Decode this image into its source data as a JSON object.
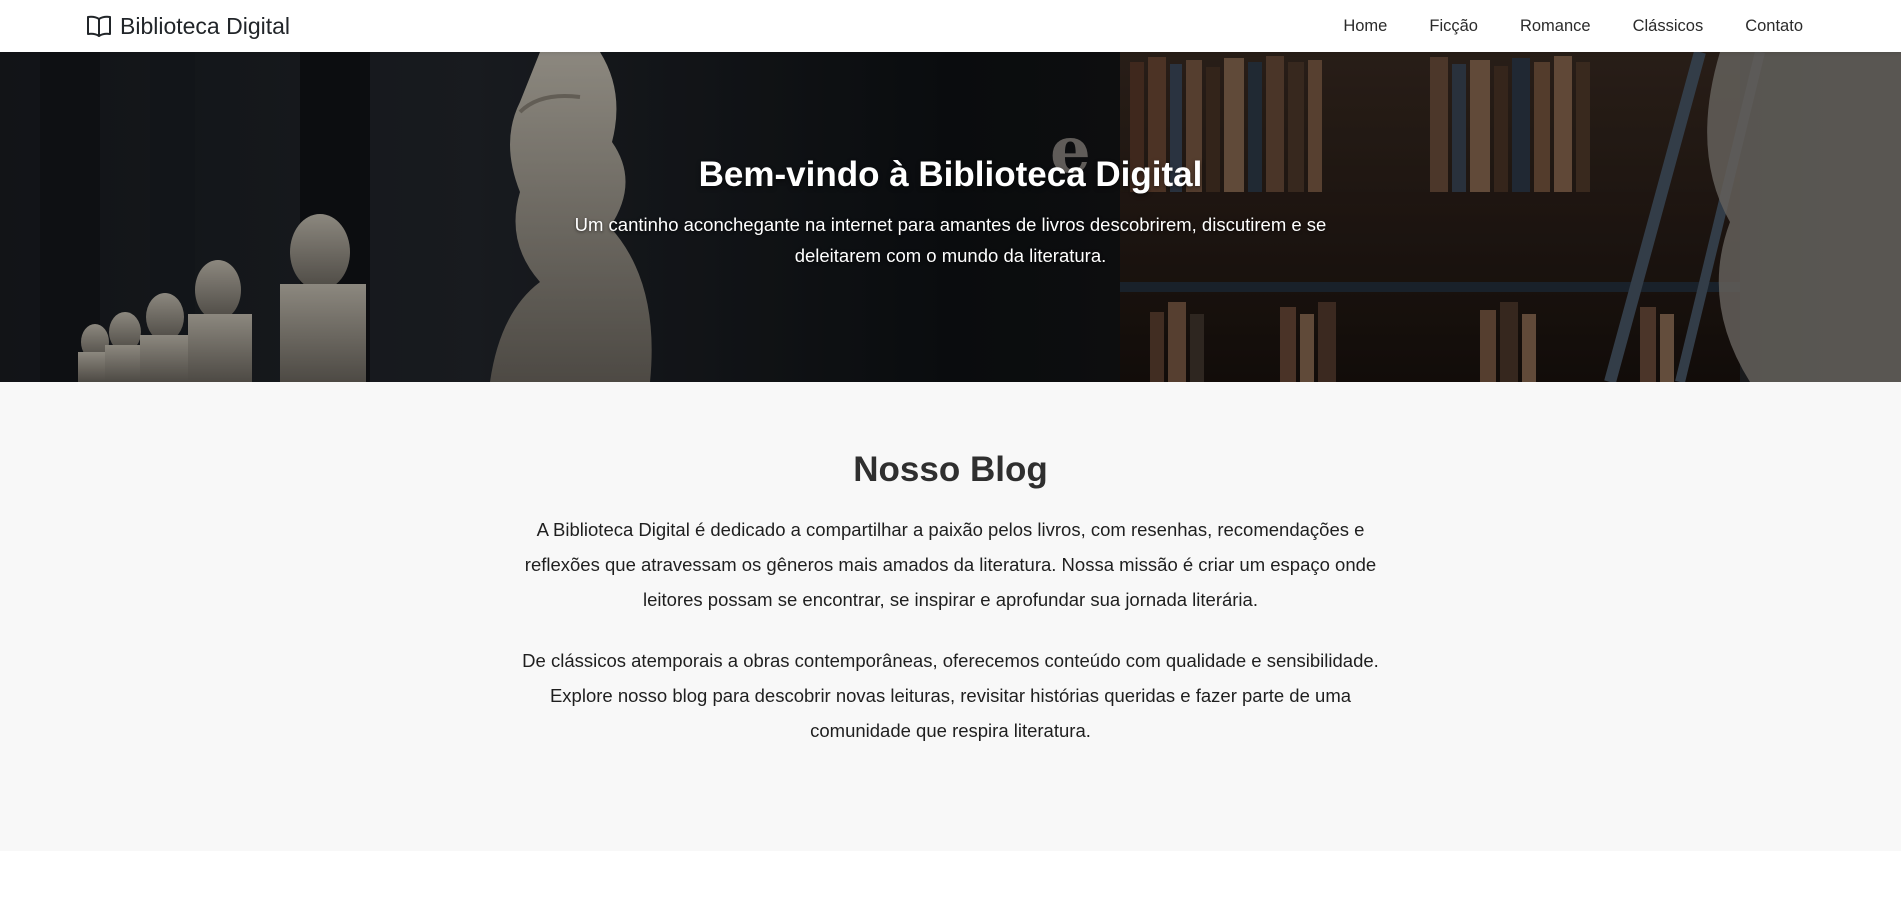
{
  "navbar": {
    "brand_icon": "open-book-icon",
    "brand_name": "Biblioteca Digital",
    "links": [
      "Home",
      "Ficção",
      "Romance",
      "Clássicos",
      "Contato"
    ]
  },
  "hero": {
    "title": "Bem-vindo à Biblioteca Digital",
    "subtitle": "Um cantinho aconchegante na internet para amantes de livros descobrirem, discutirem e se deleitarem com o mundo da literatura."
  },
  "blog": {
    "title": "Nosso Blog",
    "paragraphs": [
      "A Biblioteca Digital é dedicado a compartilhar a paixão pelos livros, com resenhas, recomendações e reflexões que atravessam os gêneros mais amados da literatura. Nossa missão é criar um espaço onde leitores possam se encontrar, se inspirar e aprofundar sua jornada literária.",
      "De clássicos atemporais a obras contemporâneas, oferecemos conteúdo com qualidade e sensibilidade. Explore nosso blog para descobrir novas leituras, revisitar histórias queridas e fazer parte de uma comunidade que respira literatura."
    ]
  },
  "colors": {
    "navbar_bg": "#ffffff",
    "hero_text": "#ffffff",
    "blog_bg": "#f8f8f8",
    "text_dark": "#212529"
  }
}
